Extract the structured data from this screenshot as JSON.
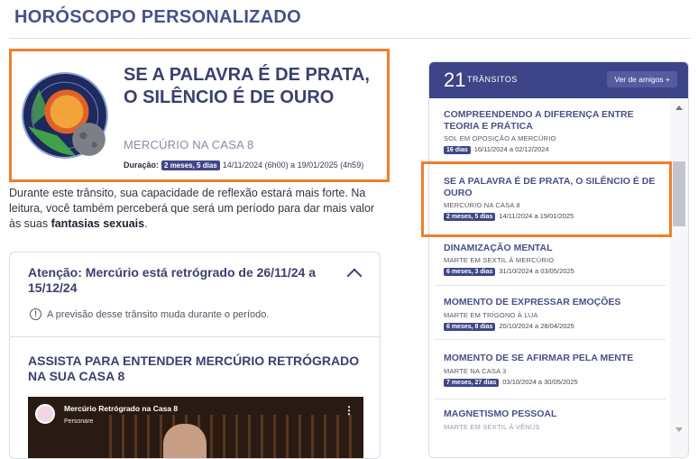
{
  "page": {
    "title": "HORÓSCOPO PERSONALIZADO"
  },
  "hero": {
    "title": "SE A PALAVRA É DE PRATA, O SILÊNCIO É DE OURO",
    "subtitle": "MERCÚRIO NA CASA 8",
    "duration_label": "Duração:",
    "duration_badge": "2 meses, 5 dias",
    "dates": "14/11/2024 (6h00) a 19/01/2025 (4h59)"
  },
  "description": {
    "text": "Durante este trânsito, sua capacidade de reflexão estará mais forte. Na leitura, você também perceberá que será um período para dar mais valor às suas ",
    "bold": "fantasias sexuais",
    "end": "."
  },
  "notice": {
    "title": "Atenção: Mercúrio está retrógrado de 26/11/24 a 15/12/24",
    "info": "A previsão desse trânsito muda durante o período.",
    "watch_title": "ASSISTA PARA ENTENDER MERCÚRIO RETRÓGRADO NA SUA CASA 8",
    "video_title": "Mercúrio Retrógrado na Casa 8",
    "video_channel": "Personare"
  },
  "transits": {
    "count": "21",
    "label": "TRÂNSITOS",
    "friends_button": "Ver de amigos +",
    "items": [
      {
        "title": "COMPREENDENDO A DIFERENÇA ENTRE TEORIA E PRÁTICA",
        "sub": "SOL EM OPOSIÇÃO A MERCÚRIO",
        "badge": "16 dias",
        "dates": "16/11/2024 a 02/12/2024"
      },
      {
        "title": "SE A PALAVRA É DE PRATA, O SILÊNCIO É DE OURO",
        "sub": "MERCÚRIO NA CASA 8",
        "badge": "2 meses, 5 dias",
        "dates": "14/11/2024 a 19/01/2025"
      },
      {
        "title": "DINAMIZAÇÃO MENTAL",
        "sub": "MARTE EM SEXTIL À MERCÚRIO",
        "badge": "6 meses, 3 dias",
        "dates": "31/10/2024 a 03/05/2025"
      },
      {
        "title": "MOMENTO DE EXPRESSAR EMOÇÕES",
        "sub": "MARTE EM TRÍGONO À LUA",
        "badge": "6 meses, 8 dias",
        "dates": "20/10/2024 a 28/04/2025"
      },
      {
        "title": "MOMENTO DE SE AFIRMAR PELA MENTE",
        "sub": "MARTE NA CASA 3",
        "badge": "7 meses, 27 dias",
        "dates": "03/10/2024 a 30/05/2025"
      },
      {
        "title": "MAGNETISMO PESSOAL",
        "sub": "MARTE EM SEXTIL À VÊNUS",
        "badge": "",
        "dates": ""
      }
    ]
  }
}
